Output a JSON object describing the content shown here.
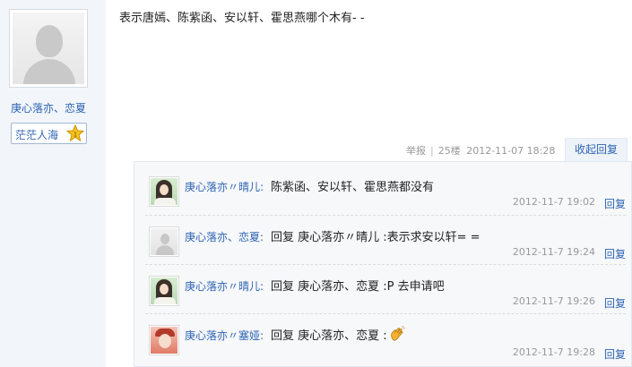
{
  "author": {
    "name": "庚心落亦、恋夏",
    "badge": "茫茫人海",
    "badge_level": "1"
  },
  "post": {
    "text": "表示唐嫣、陈紫函、安以轩、霍思燕哪个木有- -",
    "report_label": "举报",
    "floor": "25楼",
    "datetime": "2012-11-07 18:28",
    "collapse_label": "收起回复"
  },
  "replies": [
    {
      "user": "庚心落亦〃晴儿:",
      "text": "陈紫函、安以轩、霍思燕都没有",
      "time": "2012-11-7 19:02",
      "reply_label": "回复",
      "avatar": "girl-portrait"
    },
    {
      "user": "庚心落亦、恋夏:",
      "text": "回复 庚心落亦〃晴儿 :表示求安以轩= =",
      "time": "2012-11-7 19:24",
      "reply_label": "回复",
      "avatar": "default-avatar"
    },
    {
      "user": "庚心落亦〃晴儿:",
      "text": "回复 庚心落亦、恋夏 :P 去申请吧",
      "time": "2012-11-7 19:26",
      "reply_label": "回复",
      "avatar": "girl-portrait"
    },
    {
      "user": "庚心落亦〃塞娅:",
      "text": "回复 庚心落亦、恋夏 :",
      "time": "2012-11-7 19:28",
      "reply_label": "回复",
      "avatar": "red-portrait",
      "emoji": "wave-hand-icon"
    }
  ],
  "colors": {
    "link": "#2d64b3",
    "meta": "#999999",
    "sidebar_bg": "#f2f6fb",
    "reply_bg": "#f7f8fa"
  }
}
